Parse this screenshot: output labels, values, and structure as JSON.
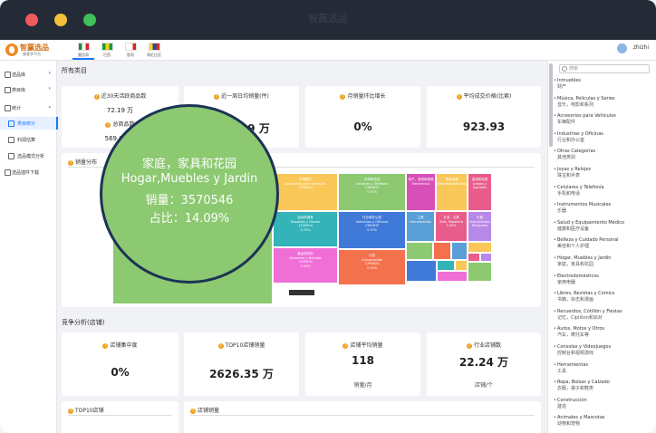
{
  "window": {
    "title": "智赢选品"
  },
  "brand": {
    "name": "智赢选品",
    "sub": "美客多平台"
  },
  "countries": [
    {
      "name": "墨西哥",
      "active": true,
      "colors": [
        "#1b8c3b",
        "#ffffff",
        "#d6262b"
      ]
    },
    {
      "name": "巴西",
      "active": false,
      "colors": [
        "#1b9c3a",
        "#f4d21f",
        "#1b9c3a"
      ]
    },
    {
      "name": "智利",
      "active": false,
      "colors": [
        "#ffffff",
        "#ffffff",
        "#d52b1e"
      ]
    },
    {
      "name": "哥伦比亚",
      "active": false,
      "colors": [
        "#f7d117",
        "#1f4aa8",
        "#d52b1e"
      ]
    }
  ],
  "user": {
    "name": "zhizhi"
  },
  "sidebar": {
    "items": [
      {
        "label": "选品库",
        "sub": false,
        "active": false,
        "chevron": "v"
      },
      {
        "label": "类目库",
        "sub": false,
        "active": false,
        "chevron": "v"
      },
      {
        "label": "统计",
        "sub": false,
        "active": false,
        "chevron": "^"
      },
      {
        "label": "类目统计",
        "sub": true,
        "active": true,
        "chevron": ""
      },
      {
        "label": "利润估算",
        "sub": true,
        "active": false,
        "chevron": ""
      },
      {
        "label": "选品模式分析",
        "sub": true,
        "active": false,
        "chevron": ""
      },
      {
        "label": "选品插件下载",
        "sub": false,
        "active": false,
        "chevron": ""
      }
    ]
  },
  "main": {
    "section1_title": "所有类目",
    "kpis_top": [
      {
        "label": "近30天活跃商品数",
        "value": "72.19 万",
        "label2": "总商品数",
        "value2": "569.04 万"
      },
      {
        "label": "近一周日均销量(件)",
        "value": "113.39 万"
      },
      {
        "label": "月销量环比增长",
        "value": "0%"
      },
      {
        "label": "平均成交价格(比索)",
        "value": "923.93"
      }
    ],
    "chart_title": "销量分布",
    "section2_title": "竞争分析(店铺)",
    "kpis_bottom": [
      {
        "label": "店铺集中度",
        "value": "0%",
        "unit": ""
      },
      {
        "label": "TOP10店铺销量",
        "value": "2626.35 万",
        "unit": ""
      },
      {
        "label": "店铺平均销量",
        "value": "118",
        "unit": "销量/月"
      },
      {
        "label": "行业店铺数",
        "value": "22.24 万",
        "unit": "店铺/个"
      }
    ],
    "bottom_cards": [
      "TOP10店铺",
      "店铺销量"
    ]
  },
  "tooltip": {
    "line1": "家庭，家具和花园",
    "line2": "Hogar,Muebles y Jardin",
    "line3": "销量：3570546",
    "line4": "占比：14.09%"
  },
  "chart_data": {
    "type": "treemap",
    "title": "销量分布",
    "nodes": [
      {
        "name": "Hogar,Muebles y Jardin",
        "zh": "家庭，家具和花园",
        "value": 3570546,
        "share": "14.09%",
        "color": "#8cc971"
      },
      {
        "name": "Accesorios para Vehículos",
        "zh": "车辆配件",
        "value": 1956659,
        "share": "",
        "color": "#f9c858"
      },
      {
        "name": "Celulares y Telefonía",
        "zh": "手机和电话",
        "value": 1365832,
        "share": "5.37%",
        "color": "#8cc971"
      },
      {
        "name": "Deportes y Fitness",
        "zh": "运动和健身",
        "value": 1456904,
        "share": "5.75%",
        "color": "#34b3b8"
      },
      {
        "name": "Industrias y Oficinas",
        "zh": "行业和办公室",
        "value": 1365832,
        "share": "5.37%",
        "color": "#3f7ad8"
      },
      {
        "name": "Alimentos y Bebidas",
        "zh": "食品和饮料",
        "value": 1395454,
        "share": "5.49%",
        "color": "#ef6fd7"
      },
      {
        "name": "Computación",
        "zh": "计算",
        "value": 1296825,
        "share": "5.10%",
        "color": "#f4714d"
      },
      {
        "name": "Electrónica",
        "zh": "电子，音频和视频",
        "value": 0,
        "share": "",
        "color": "#d84fb8"
      },
      {
        "name": "Electrodomésticos",
        "zh": "家用电器",
        "value": 0,
        "share": "",
        "color": "#f9c858"
      },
      {
        "name": "Juegos y Juguetes",
        "zh": "游戏和玩具",
        "value": 0,
        "share": "",
        "color": "#e85d8b"
      },
      {
        "name": "Herramientas",
        "zh": "工具",
        "value": 0,
        "share": "",
        "color": "#5b9fd8"
      },
      {
        "name": "Arte, Papelería",
        "zh": "艺术，文具",
        "value": 0,
        "share": "2.34%",
        "color": "#e85d8b"
      },
      {
        "name": "Instrumentos Musicales",
        "zh": "乐器",
        "value": 0,
        "share": "",
        "color": "#b788e8"
      }
    ]
  },
  "right": {
    "search_placeholder": "搜索",
    "categories": [
      {
        "es": "Inmuebles",
        "zh": "财产"
      },
      {
        "es": "Música, Películas y Series",
        "zh": "音乐，电影和系列"
      },
      {
        "es": "Accesorios para Vehículos",
        "zh": "车辆配件"
      },
      {
        "es": "Industrias y Oficinas",
        "zh": "行业和办公室"
      },
      {
        "es": "Otras Categorías",
        "zh": "其他类别"
      },
      {
        "es": "Joyas y Relojes",
        "zh": "珠宝和手表"
      },
      {
        "es": "Celulares y Telefonía",
        "zh": "手机和电话"
      },
      {
        "es": "Instrumentos Musicales",
        "zh": "乐器"
      },
      {
        "es": "Salud y Equipamiento Médico",
        "zh": "健康和医疗设备"
      },
      {
        "es": "Belleza y Cuidado Personal",
        "zh": "美容和个人护理"
      },
      {
        "es": "Hogar, Muebles y Jardín",
        "zh": "家庭，家具和花园"
      },
      {
        "es": "Electrodomésticos",
        "zh": "家用电器"
      },
      {
        "es": "Libros, Revistas y Comics",
        "zh": "书籍，杂志和漫画"
      },
      {
        "es": "Recuerdos, Cotillón y Fiestas",
        "zh": "记忆，Cipillion和派对"
      },
      {
        "es": "Autos, Motos y Otros",
        "zh": "汽车，摩托车等"
      },
      {
        "es": "Consolas y Videojuegos",
        "zh": "控制台和视频游戏"
      },
      {
        "es": "Herramientas",
        "zh": "工具"
      },
      {
        "es": "Ropa, Bolsas y Calzado",
        "zh": "衣服，袋子和鞋类"
      },
      {
        "es": "Construcción",
        "zh": "建造"
      },
      {
        "es": "Animales y Mascotas",
        "zh": "动物和宠物"
      }
    ]
  }
}
